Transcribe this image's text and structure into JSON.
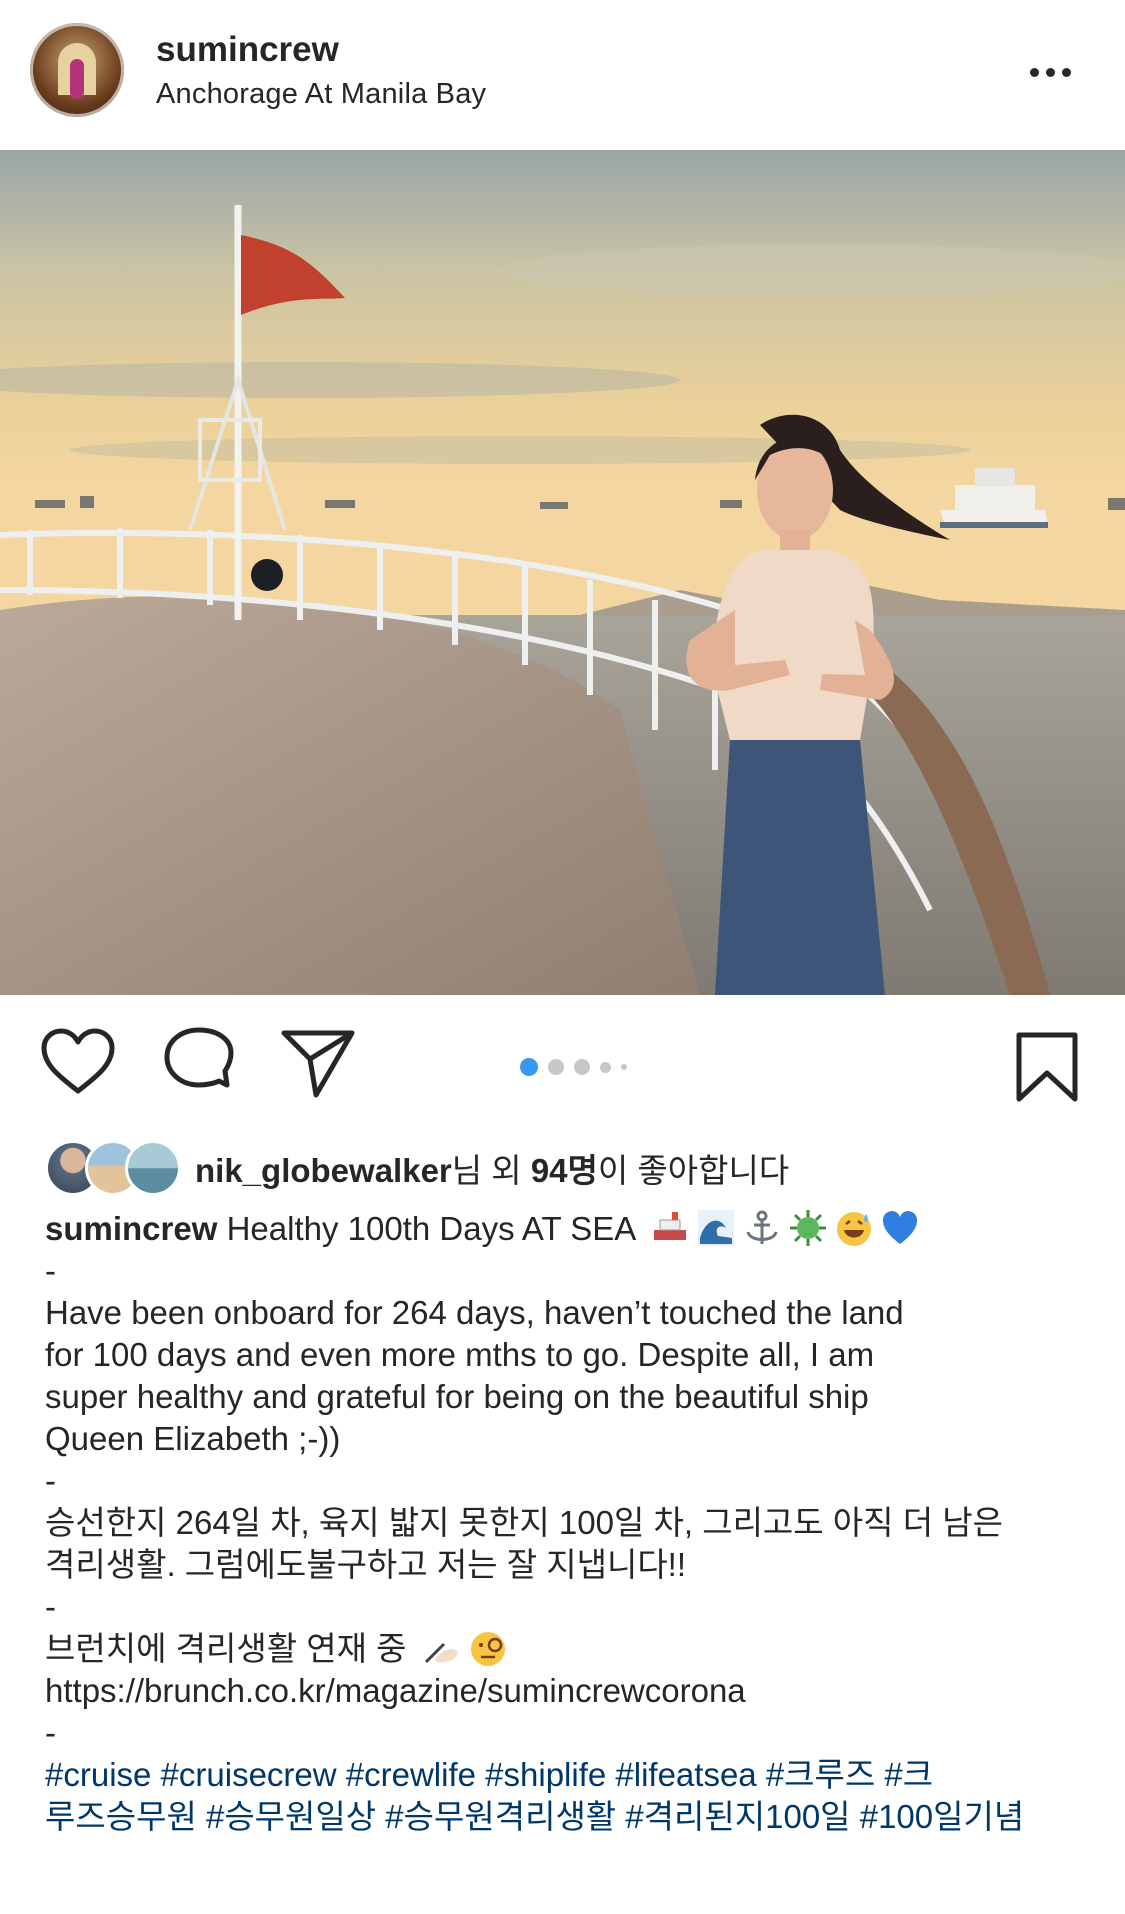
{
  "header": {
    "username": "sumincrew",
    "location": "Anchorage At Manila Bay",
    "more_icon": "more-horizontal-icon"
  },
  "actions": {
    "like_icon": "heart-icon",
    "comment_icon": "comment-icon",
    "share_icon": "send-icon",
    "save_icon": "bookmark-icon",
    "carousel_total": 5,
    "carousel_active": 1,
    "active_color": "#3897f0"
  },
  "likes": {
    "user": "nik_globewalker",
    "mid": "님 외 ",
    "count": "94명",
    "tail": "이 좋아합니다"
  },
  "caption": {
    "username": "sumincrew",
    "title": "Healthy 100th Days AT SEA",
    "title_emojis": [
      "ship-emoji",
      "wave-emoji",
      "anchor-emoji",
      "microbe-emoji",
      "sweat-smile-emoji",
      "blue-heart-emoji"
    ],
    "sep1": "-",
    "en_lines": [
      "Have been onboard for 264 days, haven’t touched the land",
      "for 100 days and even more mths to go. Despite all, I am",
      "super healthy and grateful for being on the beautiful ship",
      "Queen Elizabeth ;-))"
    ],
    "sep2": "-",
    "ko_lines": [
      "승선한지 264일 차, 육지 밟지 못한지 100일 차, 그리고도 아직 더 남은",
      "격리생활. 그럼에도불구하고 저는 잘 지냅니다!!"
    ],
    "sep3": "-",
    "brunch_line": "브런치에 격리생활 연재 중",
    "brunch_emojis": [
      "writing-hand-emoji",
      "monocle-face-emoji"
    ],
    "link": "https://brunch.co.kr/magazine/sumincrewcorona",
    "sep4": "-",
    "hashtags_line1": "#cruise #cruisecrew #crewlife #shiplife #lifeatsea #크루즈 #크",
    "hashtags_line2": "루즈승무원 #승무원일상 #승무원격리생활 #격리된지100일 #100일기념"
  }
}
